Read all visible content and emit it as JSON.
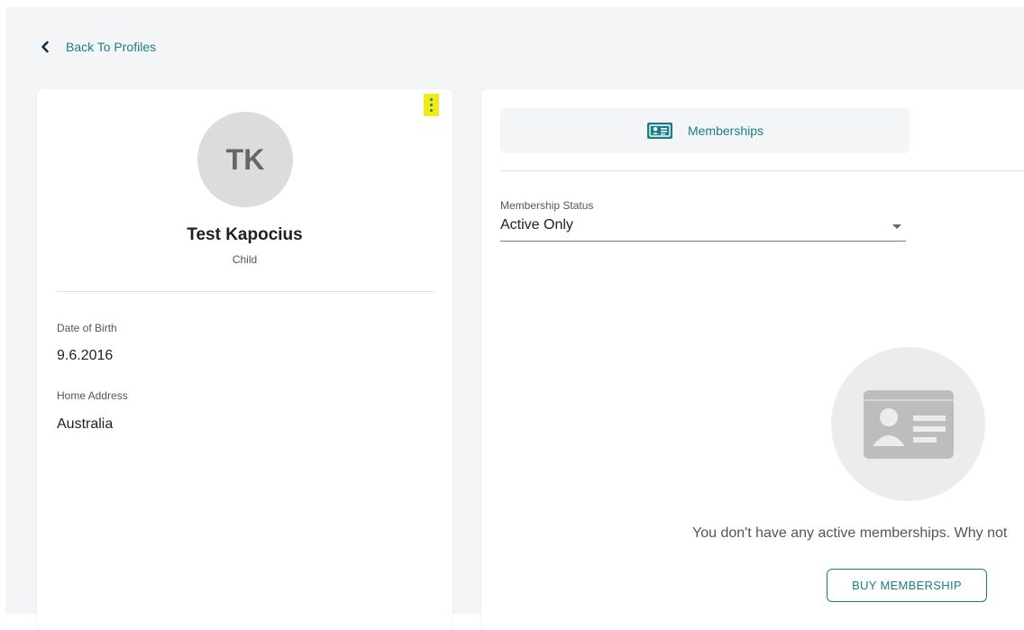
{
  "navigation": {
    "back_label": "Back To Profiles"
  },
  "profile": {
    "initials": "TK",
    "name": "Test Kapocius",
    "role": "Child",
    "fields": [
      {
        "label": "Date of Birth",
        "value": "9.6.2016"
      },
      {
        "label": "Home Address",
        "value": "Australia"
      }
    ]
  },
  "memberships": {
    "tab_label": "Memberships",
    "status_filter": {
      "label": "Membership Status",
      "selected": "Active Only"
    },
    "empty_message": "You don't have any active memberships. Why not",
    "buy_button_label": "BUY MEMBERSHIP"
  },
  "icons": {
    "back": "chevron-left-icon",
    "menu": "more-vertical-icon",
    "tab": "id-card-icon",
    "empty_state": "id-card-icon"
  },
  "colors": {
    "accent": "#1b7e87",
    "highlight": "#f2ea17",
    "page_background": "#f4f5f6",
    "avatar_background": "#dcdcdc"
  }
}
